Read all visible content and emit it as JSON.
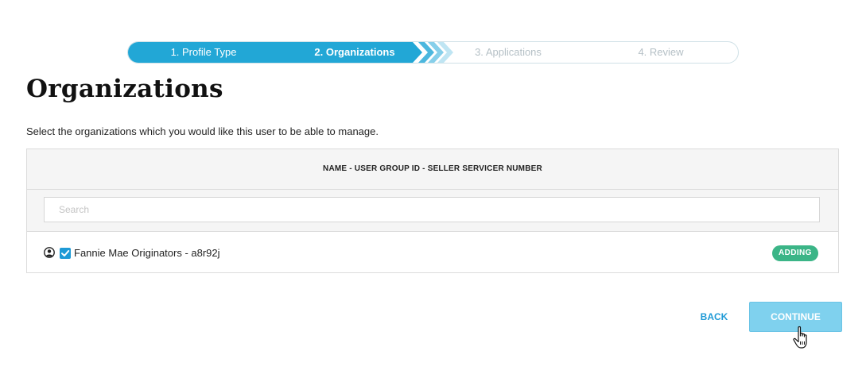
{
  "stepper": {
    "steps": [
      {
        "label": "1. Profile Type",
        "state": "complete"
      },
      {
        "label": "2. Organizations",
        "state": "current"
      },
      {
        "label": "3. Applications",
        "state": "upcoming"
      },
      {
        "label": "4. Review",
        "state": "upcoming"
      }
    ],
    "colors": {
      "active": "#22a7d6",
      "inactive_text": "#b5c0c6"
    }
  },
  "page": {
    "title": "Organizations",
    "instructions": "Select the organizations which you would like this user to be able to manage."
  },
  "table": {
    "header": "NAME - USER GROUP ID - SELLER SERVICER NUMBER",
    "search": {
      "placeholder": "Search",
      "value": ""
    },
    "rows": [
      {
        "icon": "user-circle-icon",
        "checked": true,
        "name": "Fannie Mae Originators - a8r92j",
        "status": "ADDING",
        "status_color": "#3bb587"
      }
    ]
  },
  "actions": {
    "back_label": "BACK",
    "continue_label": "CONTINUE",
    "accent_color": "#1e9ad6",
    "continue_color": "#7fd1ee"
  },
  "cursor": {
    "icon": "hand-pointer-icon"
  }
}
